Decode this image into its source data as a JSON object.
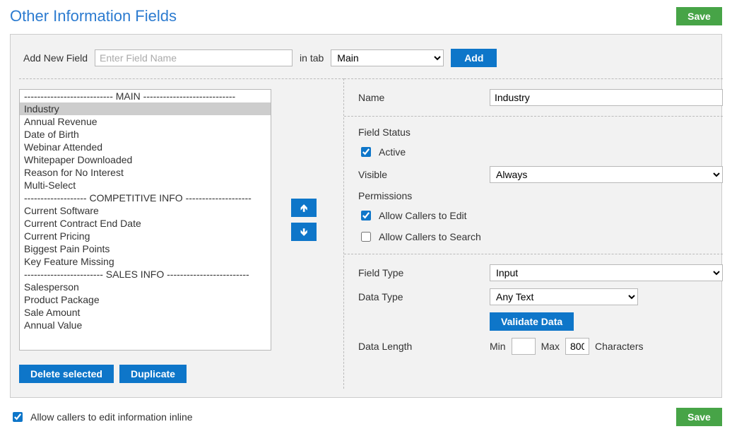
{
  "header": {
    "title": "Other Information Fields",
    "save_btn": "Save"
  },
  "add_row": {
    "label": "Add New Field",
    "placeholder": "Enter Field Name",
    "in_tab_label": "in tab",
    "tab_selected": "Main",
    "add_btn": "Add"
  },
  "fields_list": {
    "selected_index": 1,
    "items": [
      "--------------------------- MAIN ----------------------------",
      "Industry",
      "Annual Revenue",
      "Date of Birth",
      "Webinar Attended",
      "Whitepaper Downloaded",
      "Reason for No Interest",
      "Multi-Select",
      "------------------- COMPETITIVE INFO --------------------",
      "Current Software",
      "Current Contract End Date",
      "Current Pricing",
      "Biggest Pain Points",
      "Key Feature Missing",
      "------------------------ SALES INFO -------------------------",
      "Salesperson",
      "Product Package",
      "Sale Amount",
      "Annual Value"
    ]
  },
  "left_buttons": {
    "delete": "Delete selected",
    "duplicate": "Duplicate"
  },
  "details": {
    "name_label": "Name",
    "name_value": "Industry",
    "status": {
      "heading": "Field Status",
      "active_label": "Active",
      "active_checked": true,
      "visible_label": "Visible",
      "visible_value": "Always"
    },
    "permissions": {
      "heading": "Permissions",
      "edit_label": "Allow Callers to Edit",
      "edit_checked": true,
      "search_label": "Allow Callers to Search",
      "search_checked": false
    },
    "type": {
      "field_type_label": "Field Type",
      "field_type_value": "Input",
      "data_type_label": "Data Type",
      "data_type_value": "Any Text",
      "validate_btn": "Validate Data",
      "data_length_label": "Data Length",
      "min_label": "Min",
      "min_value": "",
      "max_label": "Max",
      "max_value": "800",
      "chars_label": "Characters"
    }
  },
  "footer": {
    "inline_edit_label": "Allow callers to edit information inline",
    "inline_edit_checked": true,
    "save_btn": "Save"
  }
}
